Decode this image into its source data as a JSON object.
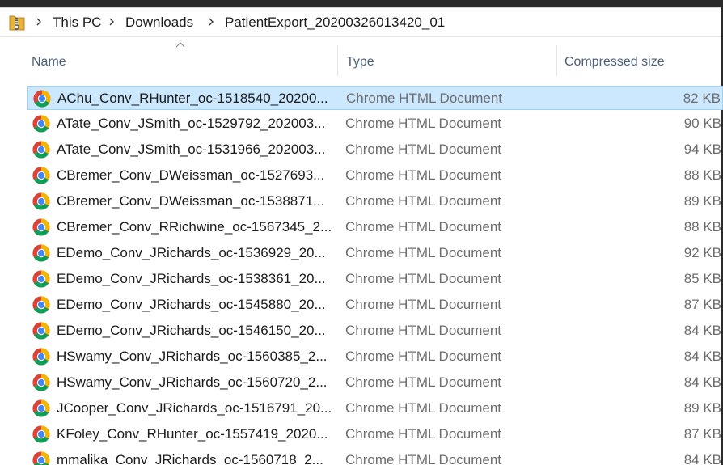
{
  "breadcrumb": {
    "items": [
      "This PC",
      "Downloads",
      "PatientExport_20200326013420_01"
    ]
  },
  "columns": {
    "name": "Name",
    "type": "Type",
    "compressed_size": "Compressed size"
  },
  "colors": {
    "selection_bg": "#cce8ff",
    "selection_border": "#99d1ff",
    "header_text": "#4c607a",
    "secondary_text": "#6d6d6d"
  },
  "files": [
    {
      "name": "AChu_Conv_RHunter_oc-1518540_20200...",
      "type": "Chrome HTML Document",
      "size": "82 KB",
      "selected": true
    },
    {
      "name": "ATate_Conv_JSmith_oc-1529792_202003...",
      "type": "Chrome HTML Document",
      "size": "90 KB"
    },
    {
      "name": "ATate_Conv_JSmith_oc-1531966_202003...",
      "type": "Chrome HTML Document",
      "size": "94 KB"
    },
    {
      "name": "CBremer_Conv_DWeissman_oc-1527693...",
      "type": "Chrome HTML Document",
      "size": "88 KB"
    },
    {
      "name": "CBremer_Conv_DWeissman_oc-1538871...",
      "type": "Chrome HTML Document",
      "size": "89 KB"
    },
    {
      "name": "CBremer_Conv_RRichwine_oc-1567345_2...",
      "type": "Chrome HTML Document",
      "size": "88 KB"
    },
    {
      "name": "EDemo_Conv_JRichards_oc-1536929_20...",
      "type": "Chrome HTML Document",
      "size": "92 KB"
    },
    {
      "name": "EDemo_Conv_JRichards_oc-1538361_20...",
      "type": "Chrome HTML Document",
      "size": "85 KB"
    },
    {
      "name": "EDemo_Conv_JRichards_oc-1545880_20...",
      "type": "Chrome HTML Document",
      "size": "87 KB"
    },
    {
      "name": "EDemo_Conv_JRichards_oc-1546150_20...",
      "type": "Chrome HTML Document",
      "size": "84 KB"
    },
    {
      "name": "HSwamy_Conv_JRichards_oc-1560385_2...",
      "type": "Chrome HTML Document",
      "size": "84 KB"
    },
    {
      "name": "HSwamy_Conv_JRichards_oc-1560720_2...",
      "type": "Chrome HTML Document",
      "size": "84 KB"
    },
    {
      "name": "JCooper_Conv_JRichards_oc-1516791_20...",
      "type": "Chrome HTML Document",
      "size": "89 KB"
    },
    {
      "name": "KFoley_Conv_RHunter_oc-1557419_2020...",
      "type": "Chrome HTML Document",
      "size": "87 KB"
    },
    {
      "name": "mmalika_Conv_JRichards_oc-1560718_2...",
      "type": "Chrome HTML Document",
      "size": "84 KB"
    }
  ]
}
